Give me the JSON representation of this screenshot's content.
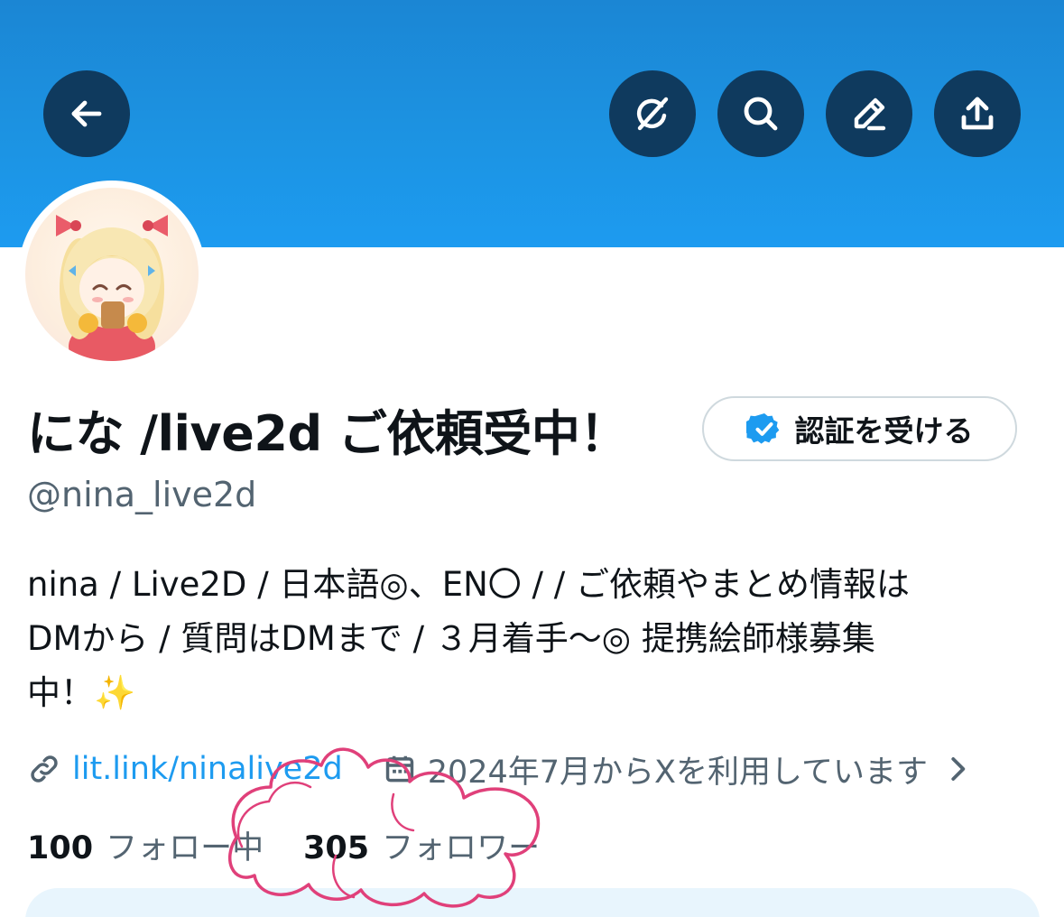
{
  "header": {
    "buttons": [
      {
        "name": "back-button",
        "icon": "arrow-left-icon"
      },
      {
        "name": "grok-button",
        "icon": "grok-icon"
      },
      {
        "name": "search-button",
        "icon": "search-icon"
      },
      {
        "name": "edit-button",
        "icon": "pencil-icon"
      },
      {
        "name": "share-button",
        "icon": "share-icon"
      }
    ],
    "banner_color": "#1d9bf0"
  },
  "profile": {
    "display_name": "にな /live2d ご依頼受中！",
    "handle": "@nina_live2d",
    "verify_label": "認証を受ける",
    "bio_lines": [
      "nina / Live2D / 日本語◎、EN〇 / / ご依頼やまとめ情報は",
      "DMから / 質問はDMまで / ３月着手〜◎ 提携絵師様募集",
      "中！✨"
    ],
    "link": "lit.link/ninalive2d",
    "joined": "2024年7月からXを利用しています",
    "following_count": "100",
    "following_label": "フォロー中",
    "followers_count": "305",
    "followers_label": "フォロワー"
  },
  "colors": {
    "accent": "#1d9bf0",
    "icon_button_bg": "#0f3a5e",
    "secondary_text": "#536471",
    "scribble": "#e0407a"
  }
}
